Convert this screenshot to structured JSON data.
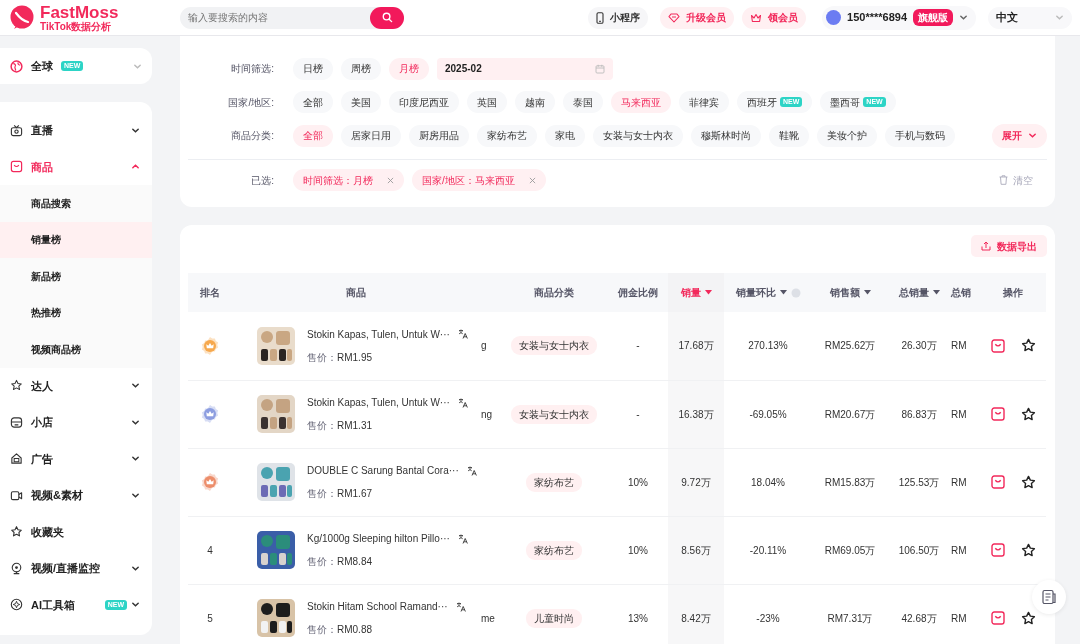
{
  "header": {
    "logo": {
      "name": "FastMoss",
      "tagline": "TikTok数据分析"
    },
    "search": {
      "placeholder": "输入要搜索的内容"
    },
    "buttons": [
      {
        "kind": "phone",
        "label": "小程序",
        "highlight": false
      },
      {
        "kind": "diamond",
        "label": "升级会员",
        "highlight": true
      },
      {
        "kind": "crown",
        "label": "领会员",
        "highlight": true
      }
    ],
    "user": {
      "phone": "150****6894",
      "badge": "旗舰版"
    },
    "language": "中文"
  },
  "sidebar": {
    "region": {
      "label": "全球",
      "badge": "NEW"
    },
    "items": [
      {
        "kind": "live",
        "label": "直播",
        "expanded": false,
        "selected": false
      },
      {
        "kind": "goods",
        "label": "商品",
        "expanded": true,
        "selected": true,
        "children": [
          {
            "label": "商品搜索",
            "selected": false
          },
          {
            "label": "销量榜",
            "selected": true
          },
          {
            "label": "新品榜",
            "selected": false
          },
          {
            "label": "热推榜",
            "selected": false
          },
          {
            "label": "视频商品榜",
            "selected": false
          }
        ]
      },
      {
        "kind": "star",
        "label": "达人",
        "expanded": false,
        "selected": false
      },
      {
        "kind": "shop",
        "label": "小店",
        "expanded": false,
        "selected": false
      },
      {
        "kind": "ad",
        "label": "广告",
        "expanded": false,
        "selected": false
      },
      {
        "kind": "video",
        "label": "视频&素材",
        "expanded": false,
        "selected": false
      },
      {
        "kind": "fav",
        "label": "收藏夹",
        "selected": false
      },
      {
        "kind": "monitor",
        "label": "视频/直播监控",
        "expanded": false,
        "selected": false
      },
      {
        "kind": "ai",
        "label": "AI工具箱",
        "badge": "NEW",
        "expanded": false,
        "selected": false
      }
    ]
  },
  "filters": {
    "rows": [
      {
        "label": "时间筛选:",
        "options": [
          {
            "label": "日榜",
            "selected": false
          },
          {
            "label": "周榜",
            "selected": false
          },
          {
            "label": "月榜",
            "selected": true
          }
        ],
        "date": "2025-02"
      },
      {
        "label": "国家/地区:",
        "options": [
          {
            "label": "全部",
            "selected": false
          },
          {
            "label": "美国",
            "selected": false
          },
          {
            "label": "印度尼西亚",
            "selected": false
          },
          {
            "label": "英国",
            "selected": false
          },
          {
            "label": "越南",
            "selected": false
          },
          {
            "label": "泰国",
            "selected": false
          },
          {
            "label": "马来西亚",
            "selected": true
          },
          {
            "label": "菲律宾",
            "selected": false
          },
          {
            "label": "西班牙",
            "selected": false,
            "badge": "NEW"
          },
          {
            "label": "墨西哥",
            "selected": false,
            "badge": "NEW"
          }
        ]
      },
      {
        "label": "商品分类:",
        "options": [
          {
            "label": "全部",
            "selected": true
          },
          {
            "label": "居家日用",
            "selected": false
          },
          {
            "label": "厨房用品",
            "selected": false
          },
          {
            "label": "家纺布艺",
            "selected": false
          },
          {
            "label": "家电",
            "selected": false
          },
          {
            "label": "女装与女士内衣",
            "selected": false
          },
          {
            "label": "穆斯林时尚",
            "selected": false
          },
          {
            "label": "鞋靴",
            "selected": false
          },
          {
            "label": "美妆个护",
            "selected": false
          },
          {
            "label": "手机与数码",
            "selected": false
          }
        ],
        "expand": "展开"
      }
    ],
    "chosen": {
      "label": "已选:",
      "tags": [
        "时间筛选：月榜",
        "国家/地区：马来西亚"
      ],
      "clear": "清空"
    }
  },
  "table": {
    "export": "数据导出",
    "columns": [
      {
        "label": "排名",
        "sort": false,
        "selected": false
      },
      {
        "label": "商品",
        "sort": false,
        "selected": false
      },
      {
        "label": "商品分类",
        "sort": false,
        "selected": false
      },
      {
        "label": "佣金比例",
        "sort": false,
        "selected": false
      },
      {
        "label": "销量",
        "sort": true,
        "selected": true
      },
      {
        "label": "销量环比",
        "sort": true,
        "help": true,
        "selected": false
      },
      {
        "label": "销售额",
        "sort": true,
        "selected": false
      },
      {
        "label": "总销量",
        "sort": true,
        "selected": false
      },
      {
        "label": "总销",
        "sort": false,
        "selected": false
      },
      {
        "label": "操作",
        "sort": false,
        "selected": false
      }
    ],
    "rows": [
      {
        "rank": {
          "kind": "medal",
          "color": "#f6a84d"
        },
        "title": "Stokin Kapas, Tulen, Untuk W···",
        "price_label": "售价：",
        "price": "RM1.95",
        "peek": "g",
        "category": "女装与女士内衣",
        "commission": "-",
        "sales": "17.68万",
        "mom": "270.13%",
        "revenue": "RM25.62万",
        "total": "26.30万",
        "column_8": "RM"
      },
      {
        "rank": {
          "kind": "medal",
          "color": "#8c9de0"
        },
        "title": "Stokin Kapas, Tulen, Untuk W···",
        "price_label": "售价：",
        "price": "RM1.31",
        "peek": "ng",
        "category": "女装与女士内衣",
        "commission": "-",
        "sales": "16.38万",
        "mom": "-69.05%",
        "revenue": "RM20.67万",
        "total": "86.83万",
        "column_8": "RM"
      },
      {
        "rank": {
          "kind": "medal",
          "color": "#ec8d6a"
        },
        "title": "DOUBLE C Sarung Bantal Cora···",
        "price_label": "售价：",
        "price": "RM1.67",
        "category": "家纺布艺",
        "commission": "10%",
        "sales": "9.72万",
        "mom": "18.04%",
        "revenue": "RM15.83万",
        "total": "125.53万",
        "column_8": "RM"
      },
      {
        "rank": {
          "kind": "number",
          "text": "4"
        },
        "title": "Kg/1000g Sleeping hilton Pillo···",
        "price_label": "售价：",
        "price": "RM8.84",
        "category": "家纺布艺",
        "commission": "10%",
        "sales": "8.56万",
        "mom": "-20.11%",
        "revenue": "RM69.05万",
        "total": "106.50万",
        "column_8": "RM"
      },
      {
        "rank": {
          "kind": "number",
          "text": "5"
        },
        "title": "Stokin Hitam School Ramand···",
        "price_label": "售价：",
        "price": "RM0.88",
        "peek": "me",
        "category": "儿童时尚",
        "commission": "13%",
        "sales": "8.42万",
        "mom": "-23%",
        "revenue": "RM7.31万",
        "total": "42.68万",
        "column_8": "RM"
      }
    ]
  }
}
